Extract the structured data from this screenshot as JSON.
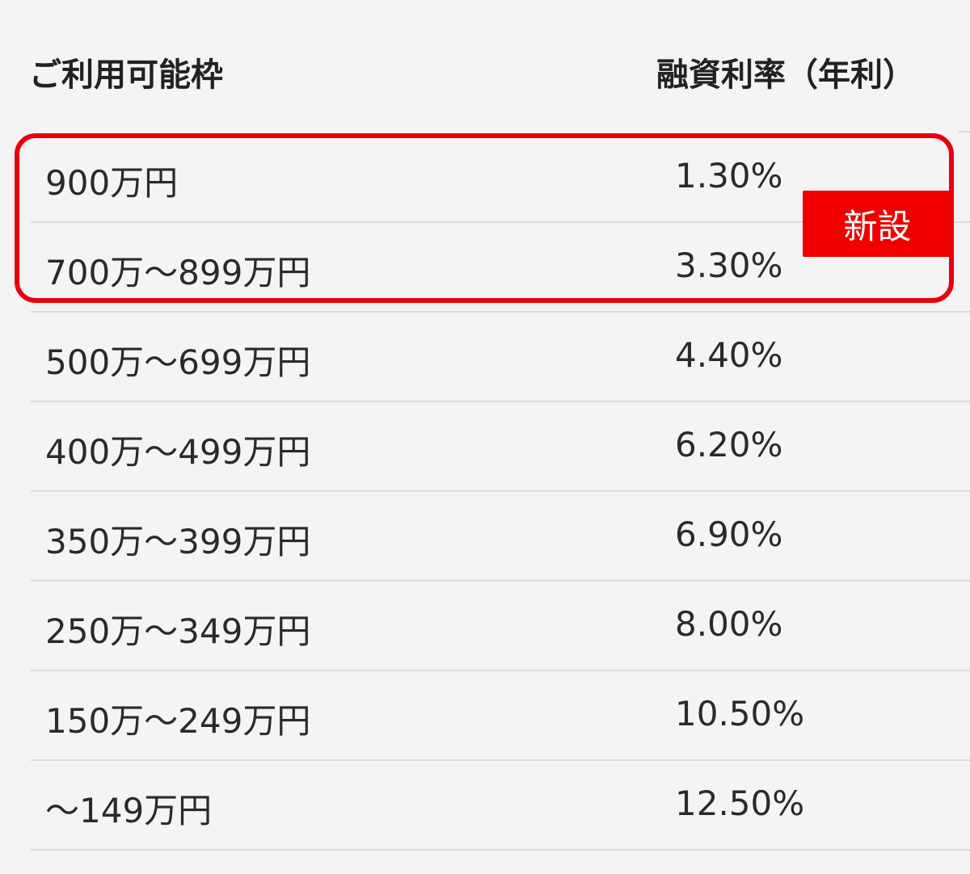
{
  "table": {
    "headers": {
      "limit": "ご利用可能枠",
      "rate": "融資利率（年利）"
    },
    "rows": [
      {
        "limit": "900万円",
        "rate": "1.30%"
      },
      {
        "limit": "700万～899万円",
        "rate": "3.30%"
      },
      {
        "limit": "500万～699万円",
        "rate": "4.40%"
      },
      {
        "limit": "400万～499万円",
        "rate": "6.20%"
      },
      {
        "limit": "350万～399万円",
        "rate": "6.90%"
      },
      {
        "limit": "250万～349万円",
        "rate": "8.00%"
      },
      {
        "limit": "150万～249万円",
        "rate": "10.50%"
      },
      {
        "limit": "～149万円",
        "rate": "12.50%"
      }
    ]
  },
  "badge": {
    "label": "新設"
  },
  "colors": {
    "highlight": "#e8000b",
    "badge_bg": "#f00000",
    "background": "#f4f4f4"
  }
}
